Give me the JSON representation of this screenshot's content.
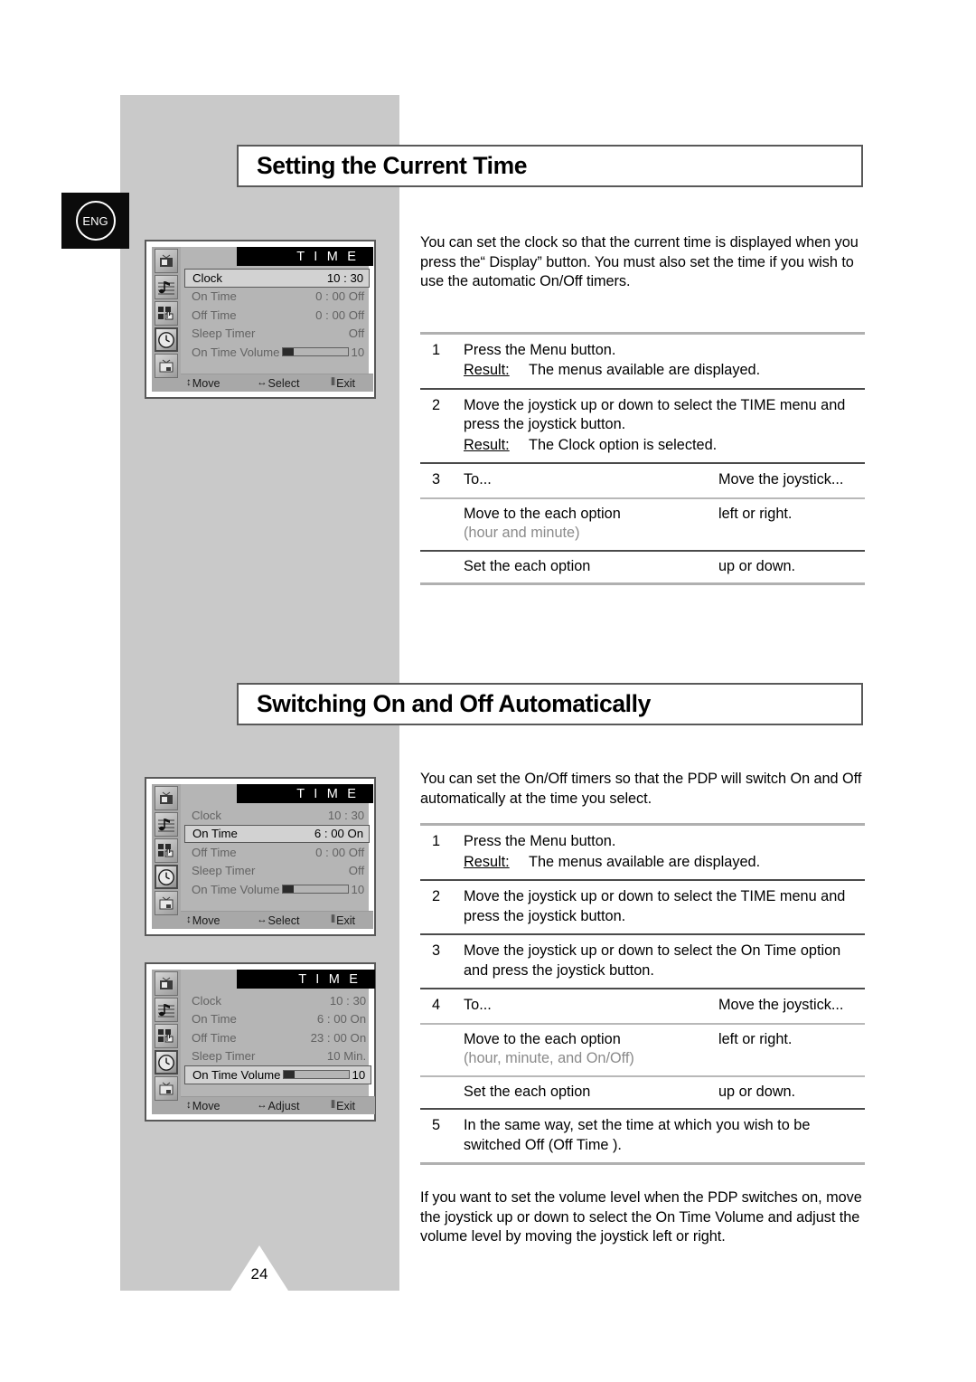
{
  "page": {
    "number": "24",
    "language_badge": "ENG"
  },
  "sections": [
    {
      "title": "Setting the Current Time",
      "intro": "You can set the clock so that the current time is displayed when you press the“ Display”  button. You must also set the time if you wish to use the automatic On/Off timers.",
      "steps": [
        {
          "num": "1",
          "text": "Press the Menu button.",
          "result_label": "Result:",
          "result_text": "The menus available are displayed."
        },
        {
          "num": "2",
          "text": "Move the joystick up or down to select the TIME menu and press the joystick button.",
          "result_label": "Result:",
          "result_text": "The Clock  option is selected."
        }
      ],
      "table": {
        "num": "3",
        "header_left": "To...",
        "header_right": "Move the joystick...",
        "rows": [
          {
            "left": "Move to the each option",
            "left_note": "(hour and minute)",
            "right": "left or right."
          },
          {
            "left": "Set the each option",
            "left_note": "",
            "right": "up or down."
          }
        ]
      }
    },
    {
      "title": "Switching On and Off Automatically",
      "intro": "You can set the On/Off timers so that the PDP will switch On and Off automatically at the time you select.",
      "steps": [
        {
          "num": "1",
          "text": "Press the Menu button.",
          "result_label": "Result:",
          "result_text": "The menus available are displayed."
        },
        {
          "num": "2",
          "text": "Move the joystick up or down to select the TIME menu and press the joystick button.",
          "result_label": "",
          "result_text": ""
        },
        {
          "num": "3",
          "text": "Move the joystick up or down to select the On Time  option and press the joystick button.",
          "result_label": "",
          "result_text": ""
        }
      ],
      "table": {
        "num": "4",
        "header_left": "To...",
        "header_right": "Move the joystick...",
        "rows": [
          {
            "left": "Move to the each option",
            "left_note": "(hour, minute, and On/Off)",
            "right": "left or right."
          },
          {
            "left": "Set the each option",
            "left_note": "",
            "right": "up or down."
          }
        ]
      },
      "final_step": {
        "num": "5",
        "text": "In the same way, set the time at which you wish to be switched Off (Off Time   )."
      },
      "outro": "If you want to set the volume level when the PDP switches on, move the joystick up or down to select the On Time Volume    and adjust the volume level by moving the joystick left or right."
    }
  ],
  "osd_menus": [
    {
      "id": "osd-time-clock",
      "title": "T I M E",
      "icons": [
        "picture-icon",
        "sound-icon",
        "feature-icon",
        "time-clock-icon",
        "pip-icon"
      ],
      "selected_icon_index": 3,
      "rows": [
        {
          "label": "Clock",
          "value": "10 : 30",
          "highlight": true,
          "type": "text"
        },
        {
          "label": "On Time",
          "value": "0 : 00 Off",
          "highlight": false,
          "type": "text"
        },
        {
          "label": "Off Time",
          "value": "0 : 00 Off",
          "highlight": false,
          "type": "text"
        },
        {
          "label": "Sleep Timer",
          "value": "Off",
          "highlight": false,
          "type": "text"
        },
        {
          "label": "On Time Volume",
          "value": "10",
          "highlight": false,
          "type": "volume",
          "volume_level": 10
        }
      ],
      "footer": [
        {
          "glyph": "↕",
          "label": "Move"
        },
        {
          "glyph": "↔",
          "label": "Select"
        },
        {
          "glyph": "⦀",
          "label": "Exit"
        }
      ]
    },
    {
      "id": "osd-time-ontime",
      "title": "T I M E",
      "icons": [
        "picture-icon",
        "sound-icon",
        "feature-icon",
        "time-clock-icon",
        "pip-icon"
      ],
      "selected_icon_index": 3,
      "rows": [
        {
          "label": "Clock",
          "value": "10 : 30",
          "highlight": false,
          "type": "text"
        },
        {
          "label": "On Time",
          "value": "6 : 00 On",
          "highlight": true,
          "type": "text"
        },
        {
          "label": "Off Time",
          "value": "0 : 00 Off",
          "highlight": false,
          "type": "text"
        },
        {
          "label": "Sleep Timer",
          "value": "Off",
          "highlight": false,
          "type": "text"
        },
        {
          "label": "On Time Volume",
          "value": "10",
          "highlight": false,
          "type": "volume",
          "volume_level": 10
        }
      ],
      "footer": [
        {
          "glyph": "↕",
          "label": "Move"
        },
        {
          "glyph": "↔",
          "label": "Select"
        },
        {
          "glyph": "⦀",
          "label": "Exit"
        }
      ]
    },
    {
      "id": "osd-time-volume",
      "title": "T I M E",
      "icons": [
        "picture-icon",
        "sound-icon",
        "feature-icon",
        "time-clock-icon",
        "pip-icon"
      ],
      "selected_icon_index": 3,
      "rows": [
        {
          "label": "Clock",
          "value": "10 : 30",
          "highlight": false,
          "type": "text"
        },
        {
          "label": "On Time",
          "value": "6 : 00 On",
          "highlight": false,
          "type": "text"
        },
        {
          "label": "Off Time",
          "value": "23 : 00 On",
          "highlight": false,
          "type": "text"
        },
        {
          "label": "Sleep Timer",
          "value": "10 Min.",
          "highlight": false,
          "type": "text"
        },
        {
          "label": "On Time Volume",
          "value": "10",
          "highlight": true,
          "type": "volume",
          "volume_level": 10
        }
      ],
      "footer": [
        {
          "glyph": "↕",
          "label": "Move"
        },
        {
          "glyph": "↔",
          "label": "Adjust"
        },
        {
          "glyph": "⦀",
          "label": "Exit"
        }
      ]
    }
  ],
  "colors": {
    "band_gray": "#c9c9c9",
    "osd_bg": "#b5b5b5",
    "osd_title_bg": "#000000",
    "rule_light": "#b0b0b0",
    "rule_dark": "#4a4a4a"
  }
}
